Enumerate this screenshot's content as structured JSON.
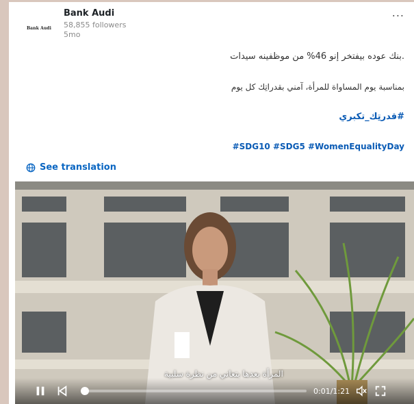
{
  "post": {
    "author": "Bank Audi",
    "logo_text": "Bank Audi",
    "followers": "58,855 followers",
    "age": "5mo",
    "more_label": "...",
    "lines": [
      ".بنك عوده بيفتخر إنو 46% من موظفينه سيدات",
      "بمناسبة يوم المساواة للمرأة، آمني بقدراتِك كل يوم",
      "#قدرتِك_تكبري",
      "#SDG10 #SDG5 #WomenEqualityDay"
    ],
    "see_translation": "See translation"
  },
  "video": {
    "subtitle": "المرأة بعدها بتعاني من نظرة سلبية",
    "time": "0:01/1:21",
    "progress": 0.012,
    "icons": {
      "play": "pause-icon",
      "prev": "skip-back-icon",
      "volume": "volume-muted-icon",
      "fullscreen": "fullscreen-icon"
    }
  },
  "colors": {
    "link": "#0a66c2",
    "background": "#d9c7bd"
  }
}
